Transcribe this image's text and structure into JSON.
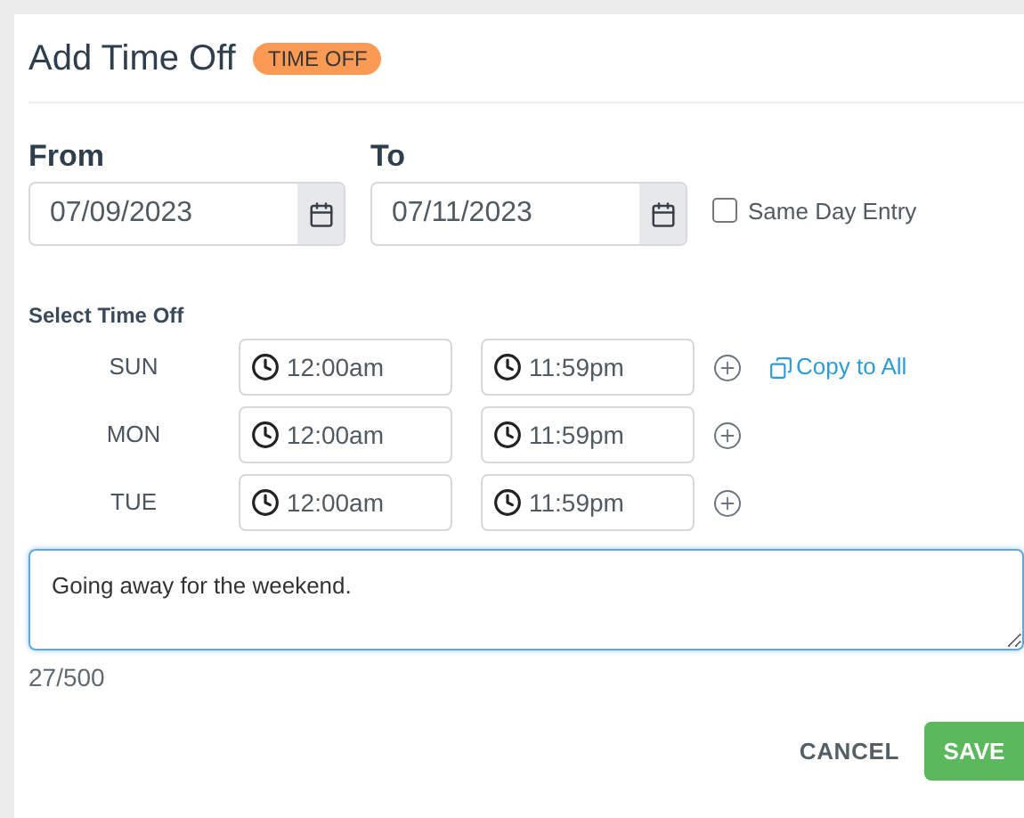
{
  "dialog": {
    "title": "Add Time Off",
    "badge": "TIME OFF"
  },
  "from": {
    "label": "From",
    "value": "07/09/2023"
  },
  "to": {
    "label": "To",
    "value": "07/11/2023"
  },
  "same_day_entry": {
    "label": "Same Day Entry",
    "checked": false
  },
  "select_time_off": {
    "label": "Select Time Off",
    "copy_to_all": "Copy to All",
    "days": [
      {
        "day": "SUN",
        "start": "12:00am",
        "end": "11:59pm"
      },
      {
        "day": "MON",
        "start": "12:00am",
        "end": "11:59pm"
      },
      {
        "day": "TUE",
        "start": "12:00am",
        "end": "11:59pm"
      }
    ]
  },
  "note": {
    "value": "Going away for the weekend.",
    "count": "27/500"
  },
  "buttons": {
    "cancel": "CANCEL",
    "save": "SAVE"
  }
}
